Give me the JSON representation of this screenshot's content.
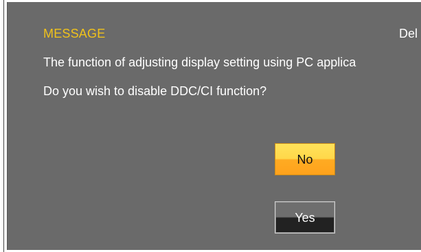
{
  "dialog": {
    "title": "MESSAGE",
    "brand": "Del",
    "line1": "The function of adjusting display setting using PC applica",
    "line2": "Do you wish to disable DDC/CI function?"
  },
  "buttons": {
    "no_label": "No",
    "yes_label": "Yes",
    "selected": "No"
  },
  "colors": {
    "background": "#6a6a6a",
    "title": "#f0c21b",
    "text": "#ffffff",
    "selected_button": "#ffc233",
    "unselected_button": "#2a2a2a"
  }
}
